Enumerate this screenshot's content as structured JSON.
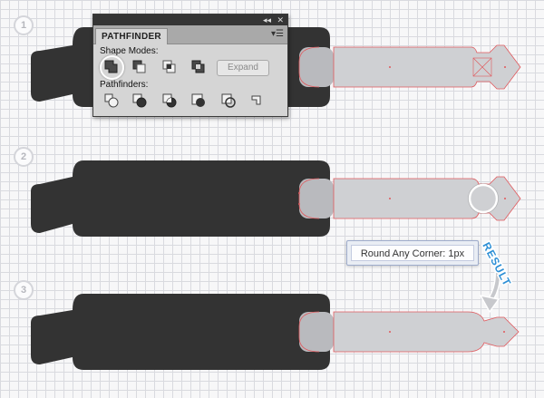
{
  "steps": [
    {
      "number": "1"
    },
    {
      "number": "2"
    },
    {
      "number": "3"
    }
  ],
  "pathfinder_panel": {
    "title": "PATHFINDER",
    "shape_modes_label": "Shape Modes:",
    "pathfinders_label": "Pathfinders:",
    "expand_label": "Expand",
    "collapse_glyph": "◂◂",
    "close_glyph": "✕",
    "menu_glyph": "▾☰",
    "shape_mode_buttons": [
      "unite-icon",
      "minus-front-icon",
      "intersect-icon",
      "exclude-icon"
    ],
    "pathfinder_buttons": [
      "divide-icon",
      "trim-icon",
      "merge-icon",
      "crop-icon",
      "outline-icon",
      "minus-back-icon"
    ]
  },
  "tooltip": {
    "text": "Round Any Corner: 1px"
  },
  "result_label": "RESULT",
  "colors": {
    "dark_body": "#333333",
    "light_shape": "#cfd0d3",
    "path_red": "#e0585c",
    "result_blue": "#2d8fd5",
    "grid": "#d9dadf"
  }
}
